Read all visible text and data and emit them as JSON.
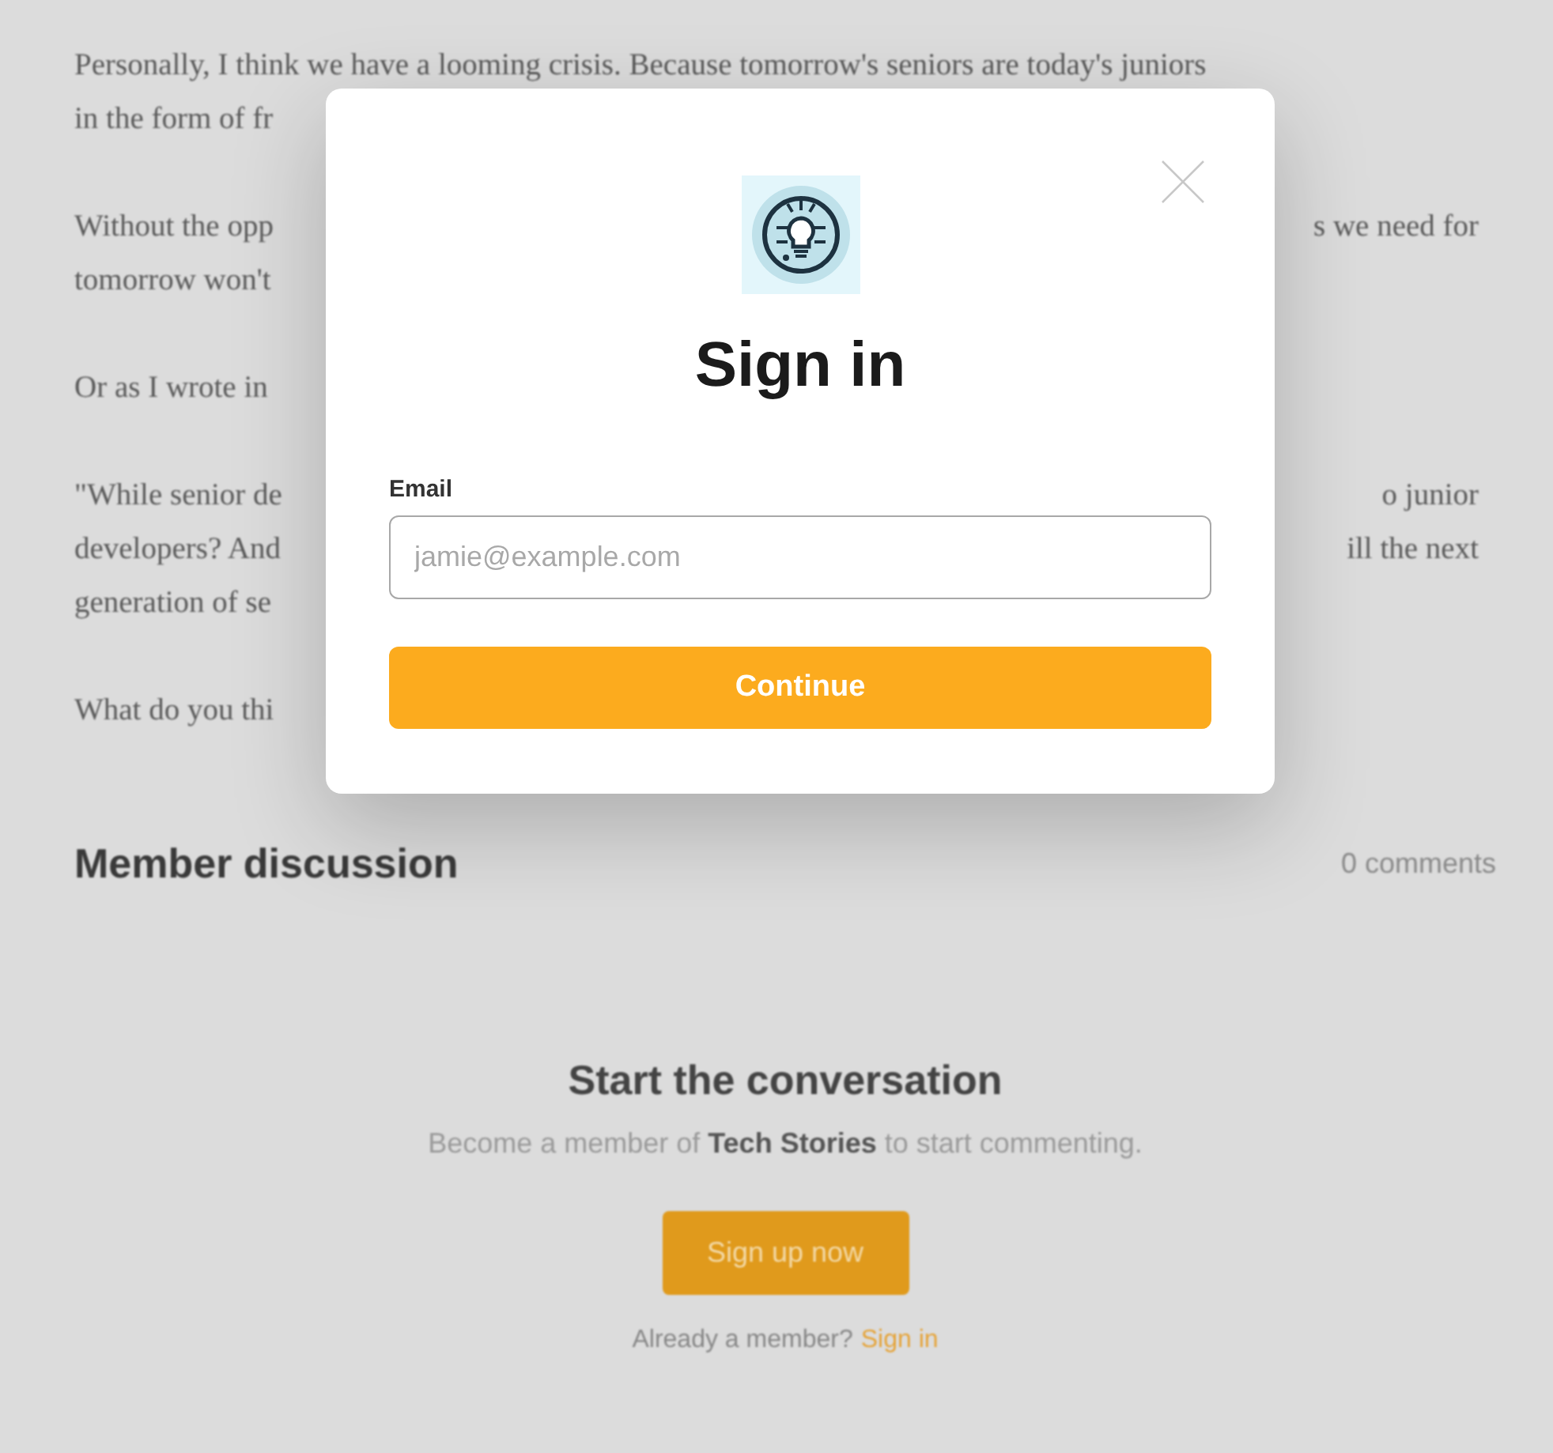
{
  "article": {
    "paragraphs": [
      {
        "lines": [
          {
            "left": "Personally, I think we have a looming crisis. Because tomorrow's seniors are today's juniors"
          },
          {
            "left": "in the form of fr"
          }
        ]
      },
      {
        "lines": [
          {
            "left": "Without the opp",
            "right": "s we need for"
          },
          {
            "left": "tomorrow won't"
          }
        ]
      },
      {
        "lines": [
          {
            "left": "Or as I wrote in"
          }
        ]
      },
      {
        "lines": [
          {
            "left": "\"While senior de",
            "right": "o junior"
          },
          {
            "left": "developers? And",
            "right": "ill the next"
          },
          {
            "left": "generation of se"
          }
        ]
      },
      {
        "lines": [
          {
            "left": "What do you thi"
          }
        ]
      }
    ]
  },
  "discussion": {
    "title": "Member discussion",
    "count": "0 comments",
    "cta_title": "Start the conversation",
    "cta_text": "Become a member of **Tech Stories** to start commenting.",
    "signup_button": "Sign up now",
    "member_prompt": "Already a member?",
    "signin_link": "Sign in"
  },
  "modal": {
    "title": "Sign in",
    "email_label": "Email",
    "email_placeholder": "jamie@example.com",
    "continue_button": "Continue"
  }
}
